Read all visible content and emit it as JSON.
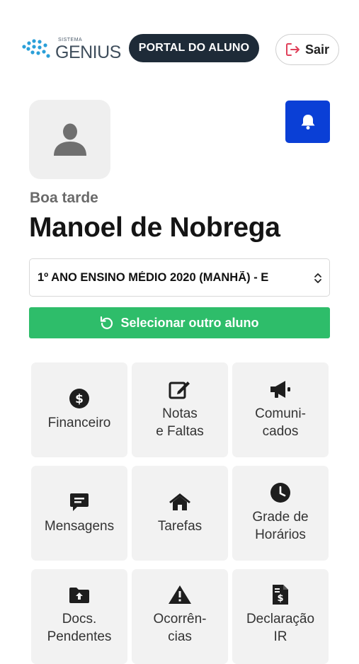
{
  "header": {
    "logo_small": "SISTEMA",
    "logo_big": "GENIUS",
    "portal_label": "PORTAL DO ALUNO",
    "logout_label": "Sair",
    "logout_icon": "sign-out-icon"
  },
  "profile": {
    "greeting": "Boa tarde",
    "name": "Manoel de Nobrega",
    "avatar_icon": "user-icon",
    "notification_icon": "bell-icon"
  },
  "class_select": {
    "selected": "1º ANO ENSINO MÉDIO 2020 (MANHÃ) - E"
  },
  "switch_student": {
    "label": "Selecionar outro aluno",
    "icon": "undo-icon"
  },
  "menu": [
    {
      "label": "Financeiro",
      "icon": "dollar-icon"
    },
    {
      "label": "Notas\ne Faltas",
      "icon": "edit-icon"
    },
    {
      "label": "Comuni-\ncados",
      "icon": "megaphone-icon"
    },
    {
      "label": "Mensagens",
      "icon": "message-icon"
    },
    {
      "label": "Tarefas",
      "icon": "home-icon"
    },
    {
      "label": "Grade de\nHorários",
      "icon": "clock-icon"
    },
    {
      "label": "Docs.\nPendentes",
      "icon": "folder-upload-icon"
    },
    {
      "label": "Ocorrên-\ncias",
      "icon": "warning-icon"
    },
    {
      "label": "Declaração\nIR",
      "icon": "invoice-icon"
    }
  ],
  "colors": {
    "portal_badge": "#1e2b38",
    "notification_button": "#0a3fd6",
    "switch_button": "#2ebd6a",
    "logout_icon": "#e0405a",
    "tile_background": "#f2f2f2"
  }
}
